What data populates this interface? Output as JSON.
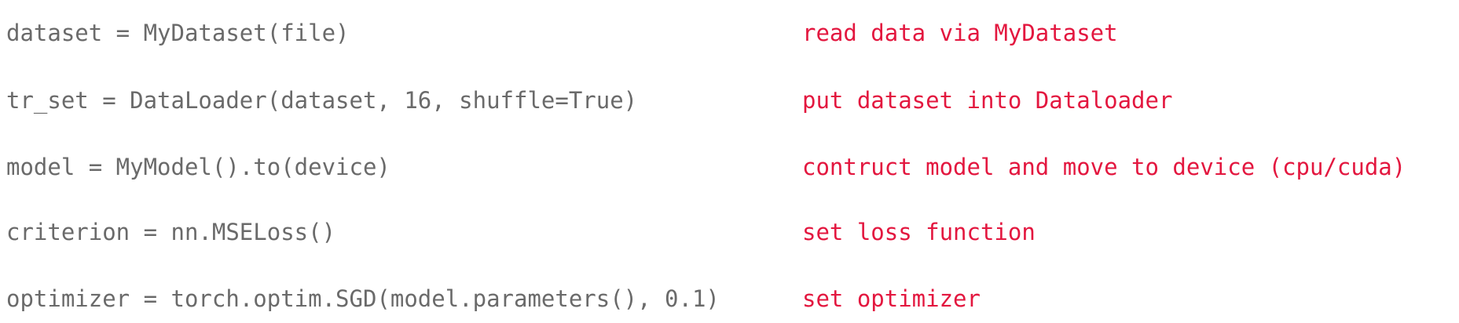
{
  "colors": {
    "code_text": "#6a6a6a",
    "comment_text": "#e3173f",
    "background": "#ffffff"
  },
  "lines": [
    {
      "code": "dataset = MyDataset(file)",
      "comment": "read data via MyDataset"
    },
    {
      "code": "tr_set = DataLoader(dataset, 16, shuffle=True)",
      "comment": "put dataset into Dataloader"
    },
    {
      "code": "model = MyModel().to(device)",
      "comment": "contruct model and move to device (cpu/cuda)"
    },
    {
      "code": "criterion = nn.MSELoss()",
      "comment": "set loss function"
    },
    {
      "code": "optimizer = torch.optim.SGD(model.parameters(), 0.1)",
      "comment": "set optimizer"
    }
  ]
}
